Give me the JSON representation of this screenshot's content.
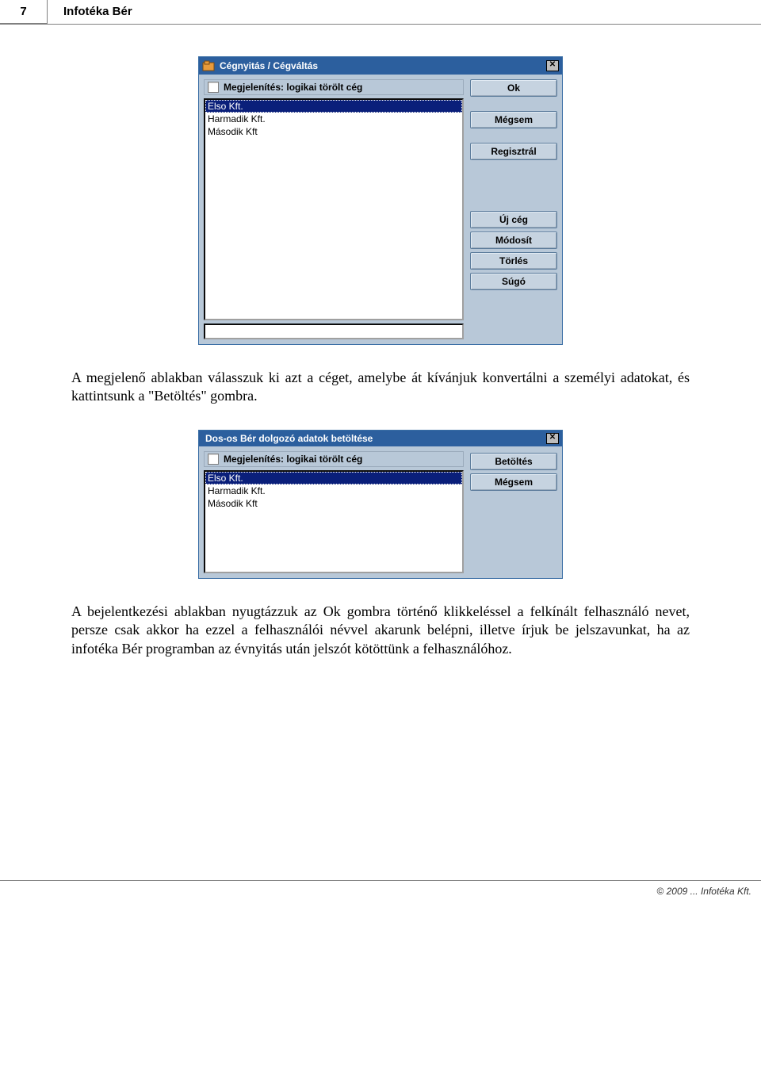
{
  "page": {
    "number": "7",
    "title": "Infotéka Bér"
  },
  "dialog1": {
    "title": "Cégnyitás / Cégváltás",
    "checkbox_label": "Megjelenítés: logikai törölt cég",
    "items": [
      "Elso Kft.",
      "Harmadik Kft.",
      "Második Kft"
    ],
    "selected_index": 0,
    "buttons": {
      "ok": "Ok",
      "cancel": "Mégsem",
      "register": "Regisztrál",
      "new_company": "Új cég",
      "modify": "Módosít",
      "delete": "Törlés",
      "help": "Súgó"
    }
  },
  "para1": "A megjelenő ablakban válasszuk ki azt a céget, amelybe át kívánjuk konvertálni a személyi adatokat, és kattintsunk a \"Betöltés\" gombra.",
  "dialog2": {
    "title": "Dos-os  Bér dolgozó adatok betöltése",
    "checkbox_label": "Megjelenítés: logikai törölt cég",
    "items": [
      "Elso Kft.",
      "Harmadik Kft.",
      "Második Kft"
    ],
    "selected_index": 0,
    "buttons": {
      "load": "Betöltés",
      "cancel": "Mégsem"
    }
  },
  "para2": "A bejelentkezési ablakban nyugtázzuk az Ok gombra történő klikkeléssel a felkínált felhasználó nevet, persze csak akkor ha ezzel a felhasználói névvel akarunk belépni, illetve írjuk be jelszavunkat, ha az infotéka Bér programban az évnyitás után jelszót kötöttünk a felhasználóhoz.",
  "footer": "© 2009 ... Infotéka Kft."
}
